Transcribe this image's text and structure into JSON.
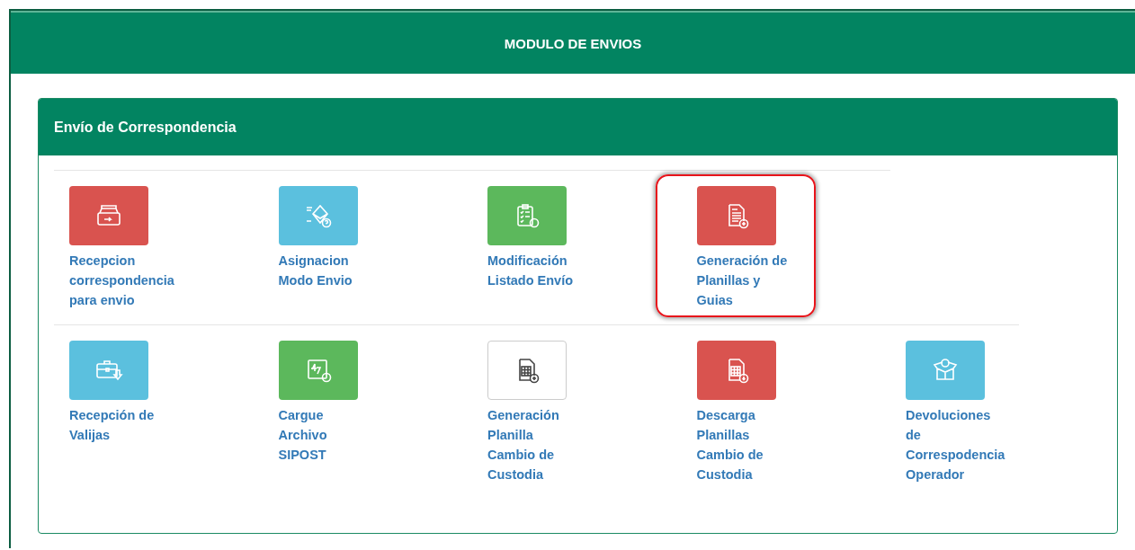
{
  "header": {
    "title": "MODULO DE ENVIOS"
  },
  "panel": {
    "title": "Envío de Correspondencia",
    "rows": [
      [
        {
          "label_lines": [
            "Recepcion",
            "correspondencia",
            "para envio"
          ],
          "color": "#d9534f",
          "highlighted": false
        },
        {
          "label_lines": [
            "Asignacion",
            "Modo Envio"
          ],
          "color": "#5bc0de",
          "highlighted": false
        },
        {
          "label_lines": [
            "Modificación",
            "Listado Envío"
          ],
          "color": "#5cb85c",
          "highlighted": false
        },
        {
          "label_lines": [
            "Generación de",
            "Planillas y",
            "Guias"
          ],
          "color": "#d9534f",
          "highlighted": true
        }
      ],
      [
        {
          "label_lines": [
            "Recepción de",
            "Valijas"
          ],
          "color": "#5bc0de",
          "highlighted": false
        },
        {
          "label_lines": [
            "Cargue",
            "Archivo",
            "SIPOST"
          ],
          "color": "#5cb85c",
          "highlighted": false
        },
        {
          "label_lines": [
            "Generación",
            "Planilla",
            "Cambio de",
            "Custodia"
          ],
          "color": "#ffffff",
          "highlighted": false
        },
        {
          "label_lines": [
            "Descarga",
            "Planillas",
            "Cambio de",
            "Custodia"
          ],
          "color": "#d9534f",
          "highlighted": false
        },
        {
          "label_lines": [
            "Devoluciones",
            "de",
            "Correspodencia",
            "Operador"
          ],
          "color": "#5bc0de",
          "highlighted": false
        }
      ]
    ]
  }
}
